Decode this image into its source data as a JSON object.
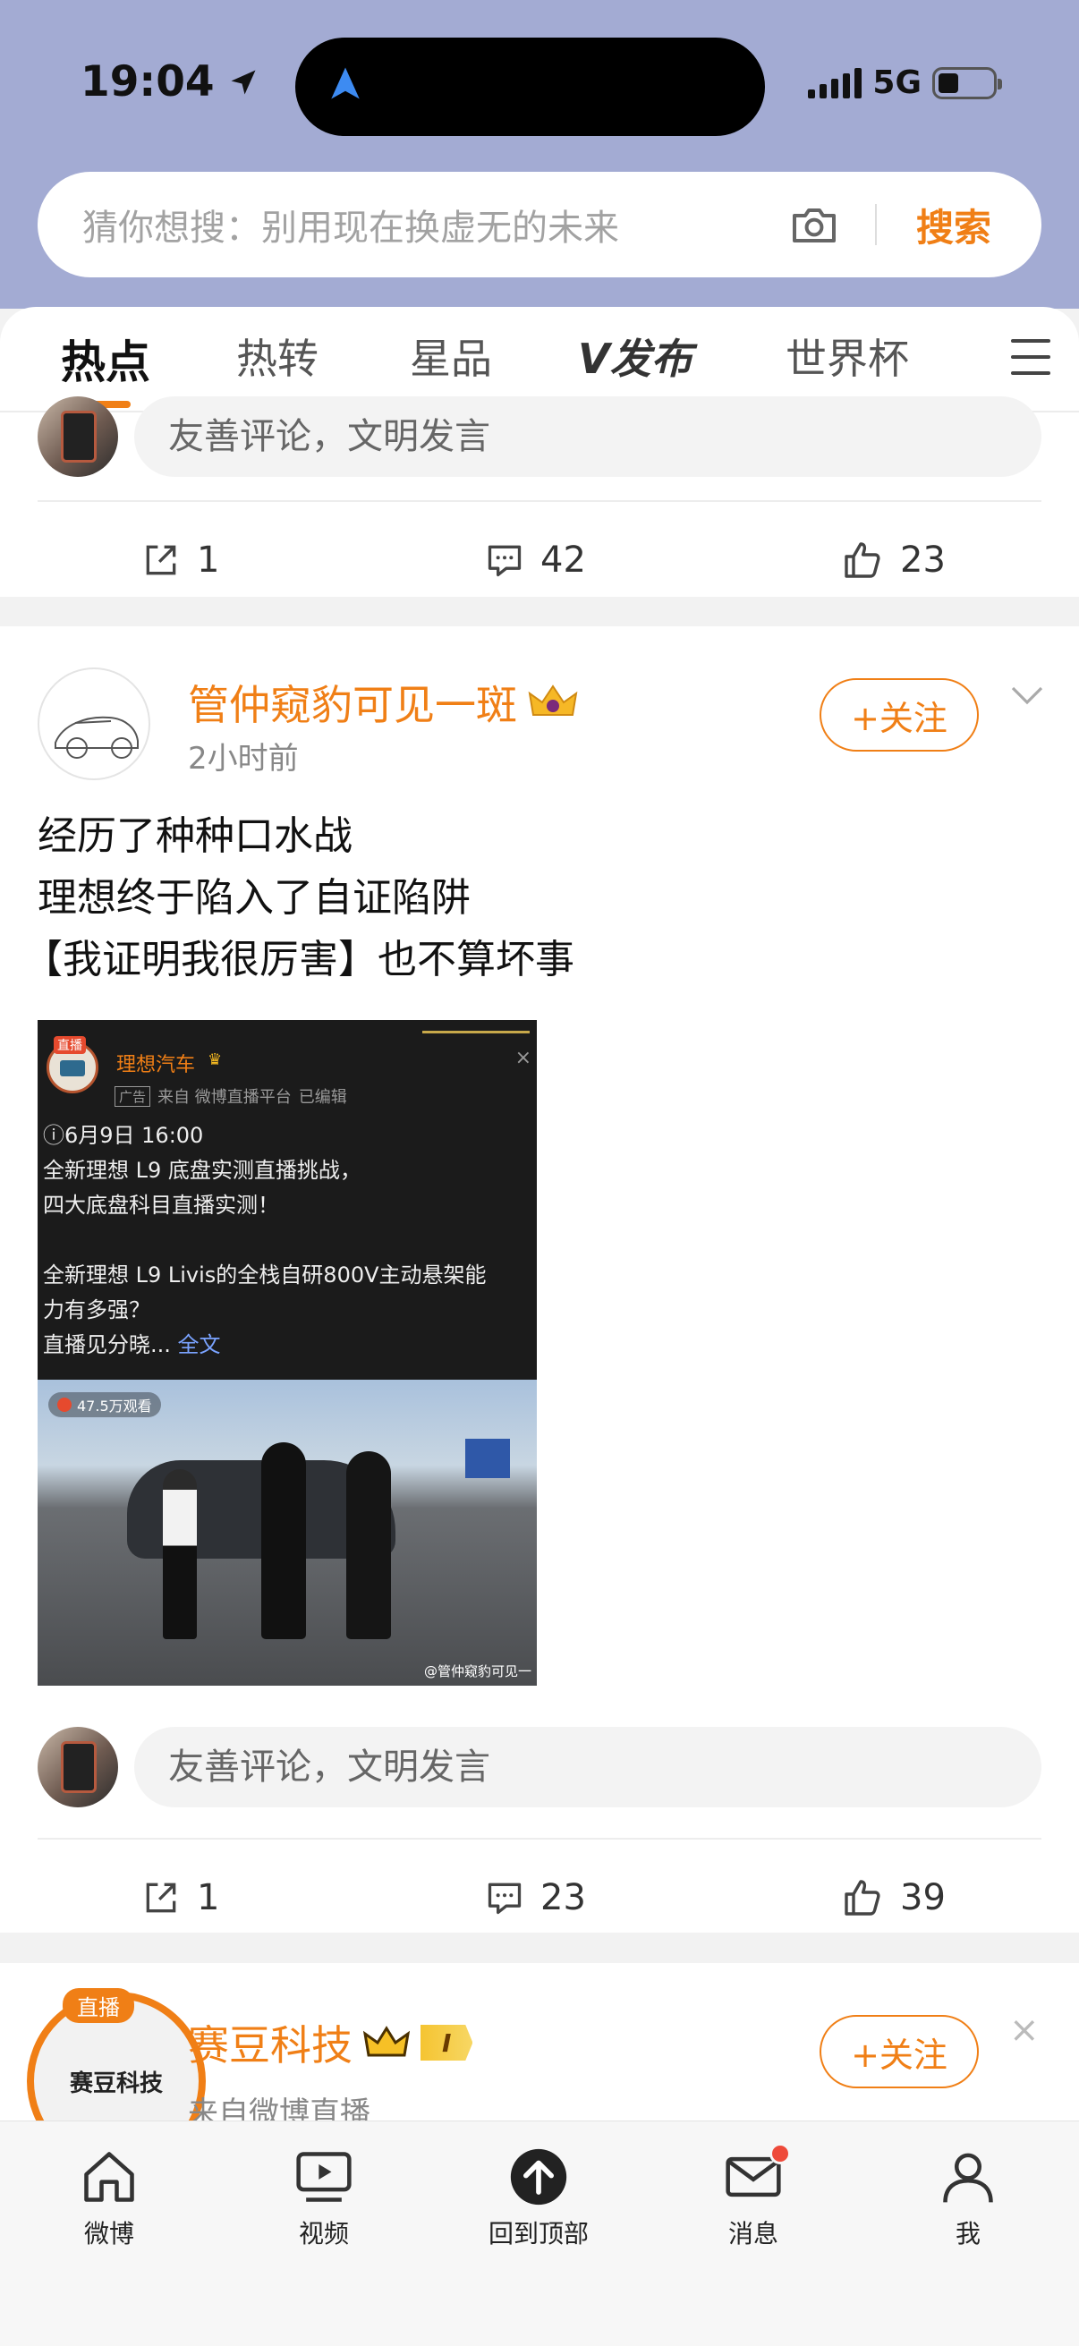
{
  "status_bar": {
    "time": "19:04",
    "network": "5G"
  },
  "search": {
    "placeholder": "猜你想搜：别用现在换虚无的未来",
    "button": "搜索"
  },
  "tabs": [
    {
      "label": "热点",
      "active": true
    },
    {
      "label": "热转"
    },
    {
      "label": "星品"
    },
    {
      "label": "V发布"
    },
    {
      "label": "世界杯"
    }
  ],
  "card_prev": {
    "comment_placeholder": "友善评论，文明发言",
    "reposts": "1",
    "comments": "42",
    "likes": "23"
  },
  "post": {
    "user": {
      "name": "管仲窥豹可见一斑",
      "time": "2小时前"
    },
    "follow_label": "+关注",
    "text": [
      "经历了种种口水战",
      "理想终于陷入了自证陷阱",
      "【我证明我很厉害】也不算坏事"
    ],
    "image": {
      "live_tag": "直播",
      "account": "理想汽车",
      "ad_label": "广告",
      "source": "来自 微博直播平台",
      "edited": "已编辑",
      "body": [
        "6月9日 16:00",
        "全新理想 L9 底盘实测直播挑战，",
        "四大底盘科目直播实测！",
        "",
        "全新理想 L9 Livis的全栈自研800V主动悬架能",
        "力有多强？"
      ],
      "tail": "直播见分晓...",
      "more": "全文",
      "views": "47.5万观看",
      "watermark": "@管仲窥豹可见一"
    },
    "comment_placeholder": "友善评论，文明发言",
    "reposts": "1",
    "comments": "23",
    "likes": "39"
  },
  "card_next": {
    "live_tag": "直播",
    "avatar_text": "赛豆科技",
    "name": "赛豆科技",
    "level": "I",
    "meta": "来自微博直播",
    "follow_label": "+关注"
  },
  "bottom_nav": [
    {
      "label": "微博",
      "icon": "home-icon"
    },
    {
      "label": "视频",
      "icon": "video-icon"
    },
    {
      "label": "回到顶部",
      "icon": "back-to-top-icon"
    },
    {
      "label": "消息",
      "icon": "mail-icon",
      "badge": true
    },
    {
      "label": "我",
      "icon": "profile-icon"
    }
  ],
  "colors": {
    "accent": "#f07f16",
    "header_bg": "#a3abd3"
  }
}
